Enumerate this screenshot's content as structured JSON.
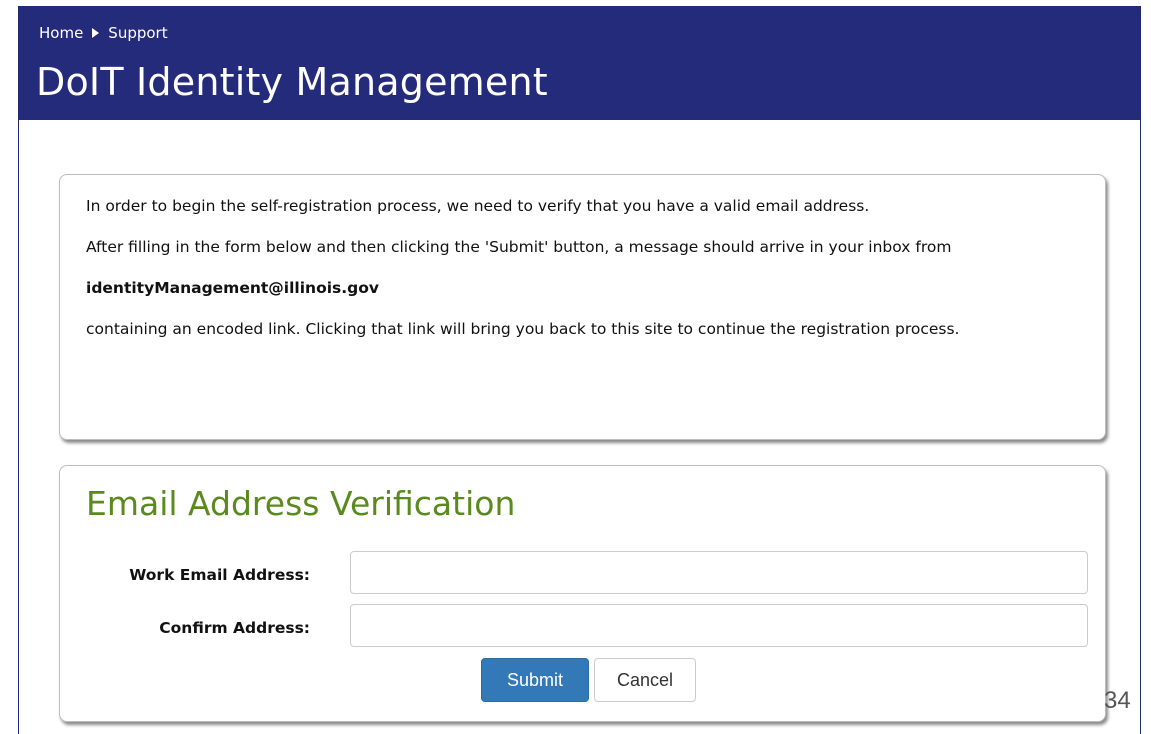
{
  "breadcrumb": {
    "home": "Home",
    "current": "Support"
  },
  "header": {
    "title": "DoIT Identity Management"
  },
  "info": {
    "line1": "In order to begin the self-registration process, we need to verify that you have a valid email address.",
    "line2": "After filling in the form below and then clicking the 'Submit' button, a message should arrive in your inbox from",
    "email": "identityManagement@illinois.gov",
    "line3": "containing an encoded link. Clicking that link will bring you back to this site to continue the registration process."
  },
  "form": {
    "title": "Email Address Verification",
    "work_email_label": "Work Email Address:",
    "work_email_value": "",
    "confirm_label": "Confirm Address:",
    "confirm_value": "",
    "submit_label": "Submit",
    "cancel_label": "Cancel"
  },
  "page_number": "34",
  "colors": {
    "header_bg": "#252b7b",
    "title_green": "#5a8a1e",
    "submit_blue": "#3379b7"
  }
}
